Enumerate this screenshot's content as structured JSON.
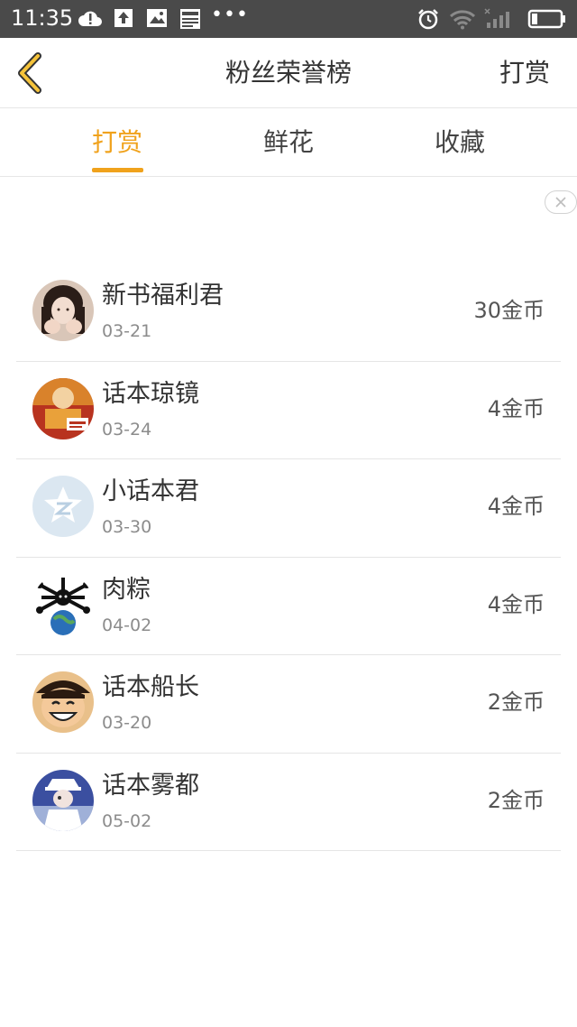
{
  "status_bar": {
    "time": "11:35",
    "dots": "•••",
    "icons": [
      "cloud-alert-icon",
      "upload-icon",
      "image-icon",
      "news-icon",
      "alarm-icon",
      "wifi-icon",
      "signal-icon",
      "battery-icon"
    ]
  },
  "header": {
    "title": "粉丝荣誉榜",
    "action": "打赏",
    "accent": "#f0a21c"
  },
  "tabs": [
    {
      "label": "打赏",
      "active": true
    },
    {
      "label": "鲜花",
      "active": false
    },
    {
      "label": "收藏",
      "active": false
    }
  ],
  "list": [
    {
      "name": "新书福利君",
      "date": "03-21",
      "amount": "30金币"
    },
    {
      "name": "话本琼镜",
      "date": "03-24",
      "amount": "4金币"
    },
    {
      "name": "小话本君",
      "date": "03-30",
      "amount": "4金币"
    },
    {
      "name": "肉粽",
      "date": "04-02",
      "amount": "4金币"
    },
    {
      "name": "话本船长",
      "date": "03-20",
      "amount": "2金币"
    },
    {
      "name": "话本雾都",
      "date": "05-02",
      "amount": "2金币"
    }
  ]
}
